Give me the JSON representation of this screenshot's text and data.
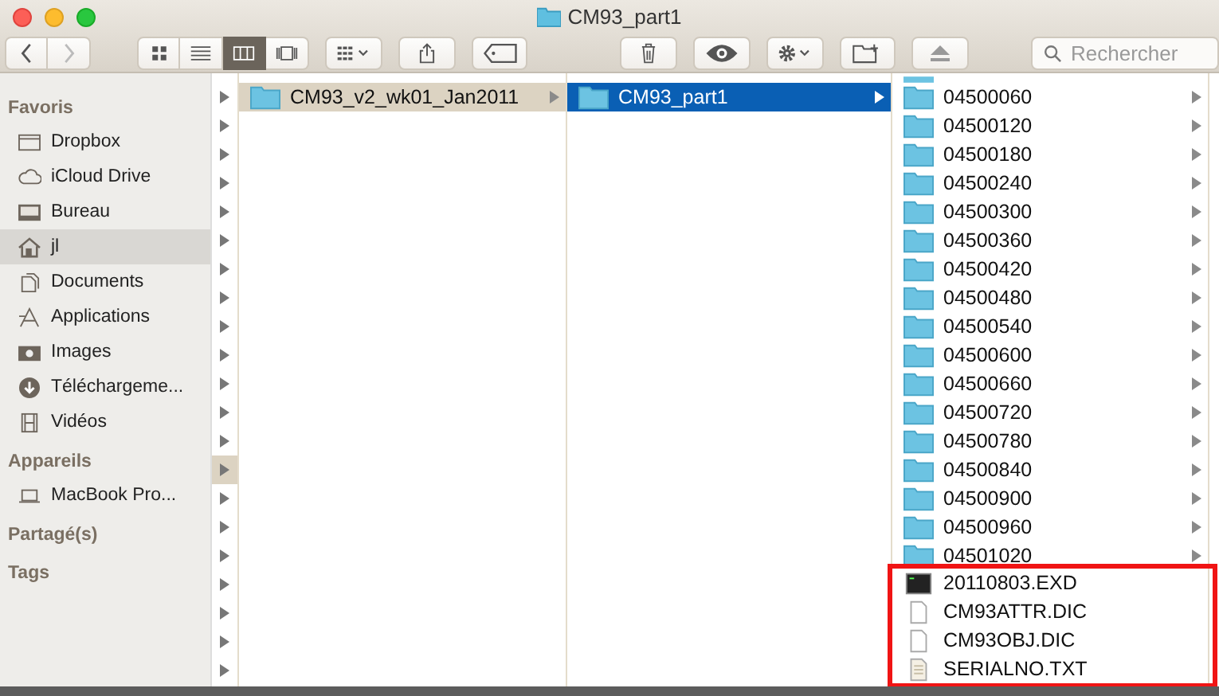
{
  "window": {
    "title": "CM93_part1"
  },
  "toolbar": {
    "view_modes": [
      {
        "kind": "icons",
        "selected": false
      },
      {
        "kind": "list",
        "selected": false
      },
      {
        "kind": "columns",
        "selected": true
      },
      {
        "kind": "coverflow",
        "selected": false
      }
    ],
    "search": {
      "placeholder": "Rechercher"
    }
  },
  "sidebar": {
    "sections": [
      {
        "title": "Favoris",
        "items": [
          {
            "label": "Dropbox",
            "kind": "dropbox",
            "selected": false
          },
          {
            "label": "iCloud Drive",
            "kind": "cloud",
            "selected": false
          },
          {
            "label": "Bureau",
            "kind": "desktop",
            "selected": false
          },
          {
            "label": "jl",
            "kind": "home",
            "selected": true
          },
          {
            "label": "Documents",
            "kind": "documents",
            "selected": false
          },
          {
            "label": "Applications",
            "kind": "applications",
            "selected": false
          },
          {
            "label": "Images",
            "kind": "camera",
            "selected": false
          },
          {
            "label": "Téléchargeme...",
            "kind": "download",
            "selected": false
          },
          {
            "label": "Vidéos",
            "kind": "film",
            "selected": false
          }
        ]
      },
      {
        "title": "Appareils",
        "items": [
          {
            "label": "MacBook Pro...",
            "kind": "laptop",
            "selected": false
          }
        ]
      },
      {
        "title": "Partagé(s)"
      },
      {
        "title": "Tags"
      }
    ]
  },
  "first_column": {
    "rows": [
      {
        "selected": false
      },
      {
        "selected": false
      },
      {
        "selected": false
      },
      {
        "selected": false
      },
      {
        "selected": false
      },
      {
        "selected": false
      },
      {
        "selected": false
      },
      {
        "selected": false
      },
      {
        "selected": false
      },
      {
        "selected": false
      },
      {
        "selected": false
      },
      {
        "selected": false
      },
      {
        "selected": false
      },
      {
        "selected": true
      },
      {
        "selected": false
      },
      {
        "selected": false
      },
      {
        "selected": false
      },
      {
        "selected": false
      },
      {
        "selected": false
      },
      {
        "selected": false
      },
      {
        "selected": false
      }
    ]
  },
  "columns": [
    {
      "focused": false,
      "items": [
        {
          "name": "CM93_v2_wk01_Jan2011",
          "kind": "folder",
          "selected": true
        }
      ]
    },
    {
      "focused": true,
      "items": [
        {
          "name": "CM93_part1",
          "kind": "folder",
          "selected": true
        }
      ]
    },
    {
      "items": [
        {
          "name": "04500060",
          "kind": "folder",
          "selected": false
        },
        {
          "name": "04500120",
          "kind": "folder",
          "selected": false
        },
        {
          "name": "04500180",
          "kind": "folder",
          "selected": false
        },
        {
          "name": "04500240",
          "kind": "folder",
          "selected": false
        },
        {
          "name": "04500300",
          "kind": "folder",
          "selected": false
        },
        {
          "name": "04500360",
          "kind": "folder",
          "selected": false
        },
        {
          "name": "04500420",
          "kind": "folder",
          "selected": false
        },
        {
          "name": "04500480",
          "kind": "folder",
          "selected": false
        },
        {
          "name": "04500540",
          "kind": "folder",
          "selected": false
        },
        {
          "name": "04500600",
          "kind": "folder",
          "selected": false
        },
        {
          "name": "04500660",
          "kind": "folder",
          "selected": false
        },
        {
          "name": "04500720",
          "kind": "folder",
          "selected": false
        },
        {
          "name": "04500780",
          "kind": "folder",
          "selected": false
        },
        {
          "name": "04500840",
          "kind": "folder",
          "selected": false
        },
        {
          "name": "04500900",
          "kind": "folder",
          "selected": false
        },
        {
          "name": "04500960",
          "kind": "folder",
          "selected": false
        },
        {
          "name": "04501020",
          "kind": "folder",
          "selected": false
        }
      ],
      "highlighted_group": {
        "items": [
          {
            "name": "20110803.EXD",
            "kind": "executable",
            "selected": false
          },
          {
            "name": "CM93ATTR.DIC",
            "kind": "document",
            "selected": false
          },
          {
            "name": "CM93OBJ.DIC",
            "kind": "document",
            "selected": false
          },
          {
            "name": "SERIALNO.TXT",
            "kind": "text",
            "selected": false
          }
        ]
      }
    }
  ]
}
